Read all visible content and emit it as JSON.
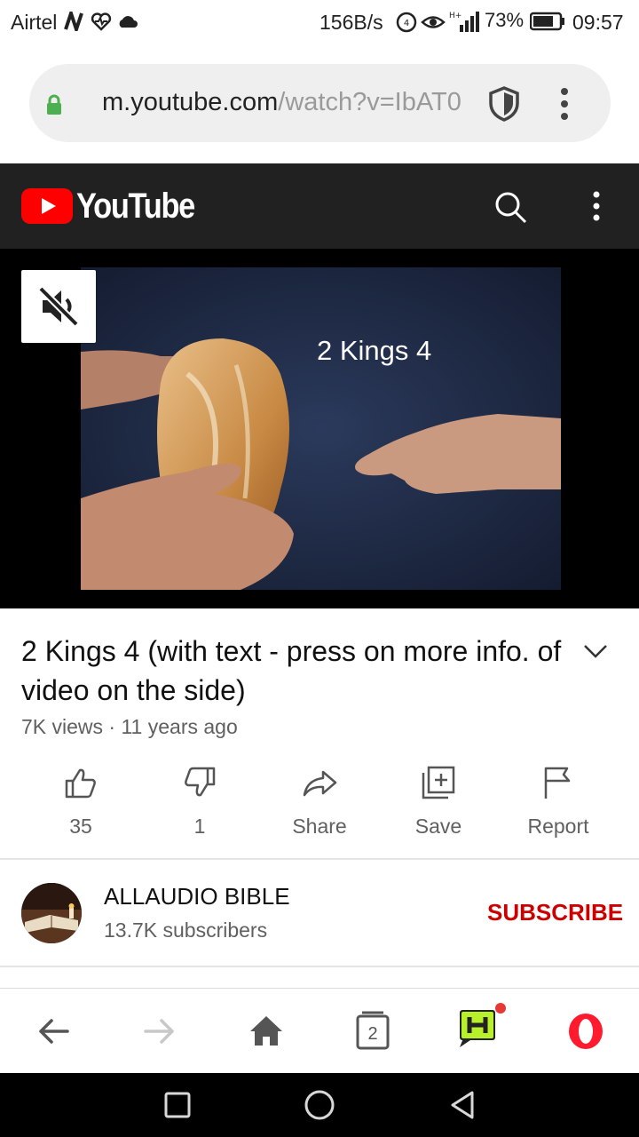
{
  "status_bar": {
    "carrier": "Airtel",
    "net_speed": "156B/s",
    "battery_percent": "73%",
    "time": "09:57"
  },
  "browser": {
    "url_host": "m.youtube.com",
    "url_path": "/watch?v=IbAT0",
    "icons": [
      "lock-icon",
      "shield-icon",
      "more-vert-icon"
    ]
  },
  "youtube_header": {
    "logo_text": "YouTube",
    "brand_color": "#ff0000",
    "icons": [
      "search-icon",
      "more-vert-icon"
    ]
  },
  "player": {
    "overlay_caption": "2 Kings 4",
    "mute_icon": "volume-off-icon"
  },
  "video": {
    "title": "2 Kings 4 (with text - press on more info. of video on the side)",
    "meta": "7K views · 11 years ago"
  },
  "actions": [
    {
      "name": "like",
      "label": "35",
      "icon": "thumb-up-icon"
    },
    {
      "name": "dislike",
      "label": "1",
      "icon": "thumb-down-icon"
    },
    {
      "name": "share",
      "label": "Share",
      "icon": "share-icon"
    },
    {
      "name": "save",
      "label": "Save",
      "icon": "playlist-add-icon"
    },
    {
      "name": "report",
      "label": "Report",
      "icon": "flag-icon"
    }
  ],
  "channel": {
    "name": "ALLAUDIO BIBLE",
    "subscribers": "13.7K subscribers",
    "subscribe_label": "SUBSCRIBE",
    "subscribe_color": "#cc0000"
  },
  "bottom_bar": {
    "tab_count": "2",
    "icons": [
      "back-arrow-icon",
      "forward-arrow-icon",
      "home-icon",
      "tabs-icon",
      "hype-icon",
      "opera-icon"
    ]
  },
  "system_nav": {
    "icons": [
      "recents-square-icon",
      "home-circle-icon",
      "back-triangle-icon"
    ]
  }
}
